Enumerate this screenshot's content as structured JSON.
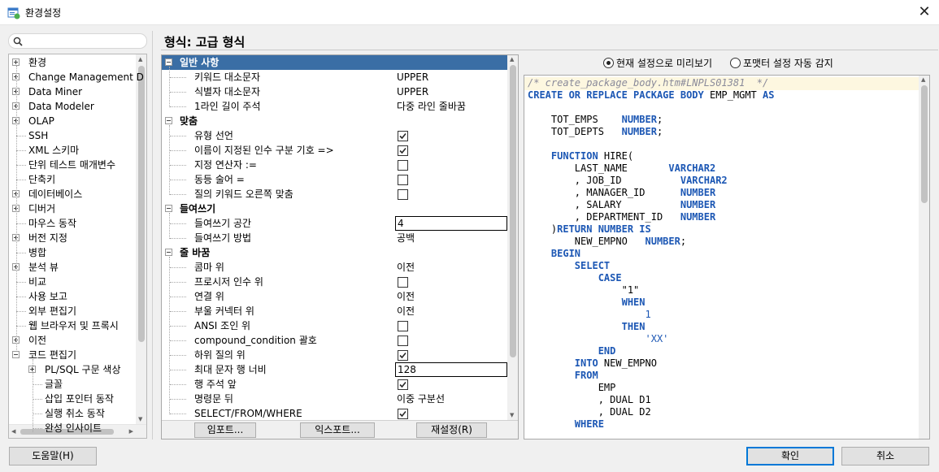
{
  "window": {
    "title": "환경설정",
    "close_glyph": "✕"
  },
  "search": {
    "placeholder": "",
    "icon": "search-icon"
  },
  "nav_tree": {
    "items": [
      {
        "label": "환경",
        "level": 0,
        "expander": "plus"
      },
      {
        "label": "Change Management D",
        "level": 0,
        "expander": "plus"
      },
      {
        "label": "Data Miner",
        "level": 0,
        "expander": "plus"
      },
      {
        "label": "Data Modeler",
        "level": 0,
        "expander": "plus"
      },
      {
        "label": "OLAP",
        "level": 0,
        "expander": "plus"
      },
      {
        "label": "SSH",
        "level": 0,
        "expander": "none"
      },
      {
        "label": "XML 스키마",
        "level": 0,
        "expander": "none"
      },
      {
        "label": "단위 테스트 매개변수",
        "level": 0,
        "expander": "none"
      },
      {
        "label": "단축키",
        "level": 0,
        "expander": "none"
      },
      {
        "label": "데이터베이스",
        "level": 0,
        "expander": "plus"
      },
      {
        "label": "디버거",
        "level": 0,
        "expander": "plus"
      },
      {
        "label": "마우스 동작",
        "level": 0,
        "expander": "none"
      },
      {
        "label": "버전 지정",
        "level": 0,
        "expander": "plus"
      },
      {
        "label": "병합",
        "level": 0,
        "expander": "none"
      },
      {
        "label": "분석 뷰",
        "level": 0,
        "expander": "plus"
      },
      {
        "label": "비교",
        "level": 0,
        "expander": "none"
      },
      {
        "label": "사용 보고",
        "level": 0,
        "expander": "none"
      },
      {
        "label": "외부 편집기",
        "level": 0,
        "expander": "none"
      },
      {
        "label": "웹 브라우저 및 프록시",
        "level": 0,
        "expander": "none"
      },
      {
        "label": "이전",
        "level": 0,
        "expander": "plus"
      },
      {
        "label": "코드 편집기",
        "level": 0,
        "expander": "minus"
      },
      {
        "label": "PL/SQL 구문 색상",
        "level": 1,
        "expander": "plus"
      },
      {
        "label": "글꼴",
        "level": 1,
        "expander": "none"
      },
      {
        "label": "삽입 포인터 동작",
        "level": 1,
        "expander": "none"
      },
      {
        "label": "실행 취소 동작",
        "level": 1,
        "expander": "none"
      },
      {
        "label": "완성 인사이트",
        "level": 1,
        "expander": "none"
      }
    ]
  },
  "page_title": "형식: 고급 형식",
  "properties": {
    "rows": [
      {
        "type": "category",
        "label": "일반 사항",
        "selected": true
      },
      {
        "type": "prop",
        "label": "키워드 대소문자",
        "value": "UPPER"
      },
      {
        "type": "prop",
        "label": "식별자 대소문자",
        "value": "UPPER"
      },
      {
        "type": "prop",
        "label": "1라인 길이 주석",
        "value": "다중 라인 줄바꿈"
      },
      {
        "type": "category",
        "label": "맞춤"
      },
      {
        "type": "check",
        "label": "유형 선언",
        "checked": true
      },
      {
        "type": "check",
        "label": "이름이 지정된 인수 구분 기호 =>",
        "checked": true
      },
      {
        "type": "check",
        "label": "지정 연산자 :=",
        "checked": false
      },
      {
        "type": "check",
        "label": "동등 술어 =",
        "checked": false
      },
      {
        "type": "check",
        "label": "질의 키워드 오른쪽 맞춤",
        "checked": false
      },
      {
        "type": "category",
        "label": "들여쓰기"
      },
      {
        "type": "input",
        "label": "들여쓰기 공간",
        "value": "4"
      },
      {
        "type": "prop",
        "label": "들여쓰기 방법",
        "value": "공백"
      },
      {
        "type": "category",
        "label": "줄 바꿈"
      },
      {
        "type": "prop",
        "label": "콤마 위",
        "value": "이전"
      },
      {
        "type": "check",
        "label": "프로시저 인수 위",
        "checked": false
      },
      {
        "type": "prop",
        "label": "연결 위",
        "value": "이전"
      },
      {
        "type": "prop",
        "label": "부울 커넥터 위",
        "value": "이전"
      },
      {
        "type": "check",
        "label": "ANSI 조인 위",
        "checked": false
      },
      {
        "type": "check",
        "label": "compound_condition 괄호",
        "checked": false
      },
      {
        "type": "check",
        "label": "하위 질의 위",
        "checked": true
      },
      {
        "type": "input",
        "label": "최대 문자 행 너비",
        "value": "128"
      },
      {
        "type": "check",
        "label": "행 주석 앞",
        "checked": true
      },
      {
        "type": "prop",
        "label": "명령문 뒤",
        "value": "이중 구분선"
      },
      {
        "type": "check",
        "label": "SELECT/FROM/WHERE",
        "checked": true
      }
    ],
    "import_label": "임포트...",
    "export_label": "익스포트...",
    "reset_label": "재설정(R)"
  },
  "preview": {
    "radio_current_label": "현재 설정으로 미리보기",
    "radio_current_checked": true,
    "radio_autodetect_label": "포맷터 설정 자동 감지",
    "radio_autodetect_checked": false,
    "code_lines": [
      [
        {
          "t": "/* create_package_body.htm#LNPLS01381  */",
          "c": "cm"
        }
      ],
      [
        {
          "t": "CREATE OR REPLACE PACKAGE BODY",
          "c": "kw"
        },
        {
          "t": " EMP_MGMT ",
          "c": ""
        },
        {
          "t": "AS",
          "c": "kw"
        }
      ],
      [],
      [
        {
          "t": "    TOT_EMPS    ",
          "c": ""
        },
        {
          "t": "NUMBER",
          "c": "kw"
        },
        {
          "t": ";",
          "c": ""
        }
      ],
      [
        {
          "t": "    TOT_DEPTS   ",
          "c": ""
        },
        {
          "t": "NUMBER",
          "c": "kw"
        },
        {
          "t": ";",
          "c": ""
        }
      ],
      [],
      [
        {
          "t": "    ",
          "c": ""
        },
        {
          "t": "FUNCTION",
          "c": "kw"
        },
        {
          "t": " HIRE(",
          "c": ""
        }
      ],
      [
        {
          "t": "        LAST_NAME       ",
          "c": ""
        },
        {
          "t": "VARCHAR2",
          "c": "kw"
        }
      ],
      [
        {
          "t": "        , JOB_ID          ",
          "c": ""
        },
        {
          "t": "VARCHAR2",
          "c": "kw"
        }
      ],
      [
        {
          "t": "        , MANAGER_ID      ",
          "c": ""
        },
        {
          "t": "NUMBER",
          "c": "kw"
        }
      ],
      [
        {
          "t": "        , SALARY          ",
          "c": ""
        },
        {
          "t": "NUMBER",
          "c": "kw"
        }
      ],
      [
        {
          "t": "        , DEPARTMENT_ID   ",
          "c": ""
        },
        {
          "t": "NUMBER",
          "c": "kw"
        }
      ],
      [
        {
          "t": "    )",
          "c": ""
        },
        {
          "t": "RETURN NUMBER IS",
          "c": "kw"
        }
      ],
      [
        {
          "t": "        NEW_EMPNO   ",
          "c": ""
        },
        {
          "t": "NUMBER",
          "c": "kw"
        },
        {
          "t": ";",
          "c": ""
        }
      ],
      [
        {
          "t": "    ",
          "c": ""
        },
        {
          "t": "BEGIN",
          "c": "kw"
        }
      ],
      [
        {
          "t": "        ",
          "c": ""
        },
        {
          "t": "SELECT",
          "c": "kw"
        }
      ],
      [
        {
          "t": "            ",
          "c": ""
        },
        {
          "t": "CASE",
          "c": "kw"
        }
      ],
      [
        {
          "t": "                \"1\"",
          "c": ""
        }
      ],
      [
        {
          "t": "                ",
          "c": ""
        },
        {
          "t": "WHEN",
          "c": "kw"
        }
      ],
      [
        {
          "t": "                    ",
          "c": ""
        },
        {
          "t": "1",
          "c": "st"
        }
      ],
      [
        {
          "t": "                ",
          "c": ""
        },
        {
          "t": "THEN",
          "c": "kw"
        }
      ],
      [
        {
          "t": "                    ",
          "c": ""
        },
        {
          "t": "'XX'",
          "c": "st"
        }
      ],
      [
        {
          "t": "            ",
          "c": ""
        },
        {
          "t": "END",
          "c": "kw"
        }
      ],
      [
        {
          "t": "        ",
          "c": ""
        },
        {
          "t": "INTO",
          "c": "kw"
        },
        {
          "t": " NEW_EMPNO",
          "c": ""
        }
      ],
      [
        {
          "t": "        ",
          "c": ""
        },
        {
          "t": "FROM",
          "c": "kw"
        }
      ],
      [
        {
          "t": "            EMP",
          "c": ""
        }
      ],
      [
        {
          "t": "            , DUAL D1",
          "c": ""
        }
      ],
      [
        {
          "t": "            , DUAL D2",
          "c": ""
        }
      ],
      [
        {
          "t": "        ",
          "c": ""
        },
        {
          "t": "WHERE",
          "c": "kw"
        }
      ]
    ]
  },
  "footer": {
    "help_label": "도움말(H)",
    "ok_label": "확인",
    "cancel_label": "취소"
  }
}
